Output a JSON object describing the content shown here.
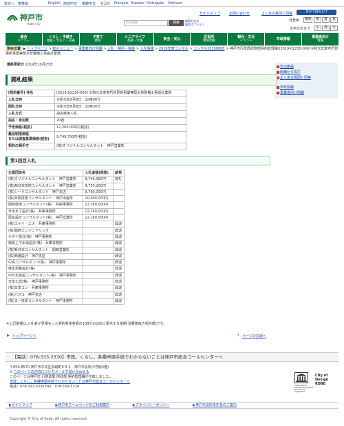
{
  "langbar": {
    "items": [
      "本文へ",
      "携帯版",
      "English",
      "简体中文",
      "繁體中文",
      "한국어",
      "Français",
      "Español",
      "Português",
      "Vietnam"
    ]
  },
  "header": {
    "logo": "神戸市",
    "logo_sub": "Kobe City",
    "sitemap": "サイトマップ",
    "contact": "お問い合わせ",
    "faq": "よくある質問と回答",
    "voice_btn": "音声で読み上げ",
    "search_placeholder": "Google",
    "search_btn": "検索",
    "help_line1": "検索の方法",
    "help_line2": "検索オプション",
    "bg_label": "背景色",
    "bg_opts": [
      "標準",
      "青",
      "黄",
      "黒"
    ],
    "fs_label": "文字の大きさ",
    "fs_opts": [
      "小",
      "標",
      "大"
    ]
  },
  "gnav": [
    {
      "label": "総合",
      "sub": "メニュー"
    },
    {
      "label": "くらし・手続き",
      "sub": "福祉・すまい・交通"
    },
    {
      "label": "子育て",
      "sub": "教育"
    },
    {
      "label": "シニアライフ",
      "sub": "高齢・介護"
    },
    {
      "label": "安全・安心",
      "sub": ""
    },
    {
      "label": "区役所",
      "sub": "地域活動"
    },
    {
      "label": "観光・文化",
      "sub": "イベント"
    },
    {
      "label": "市政情報",
      "sub": ""
    },
    {
      "label": "事業者向け",
      "sub": "情報"
    }
  ],
  "breadcrumb": {
    "label": "現在位置",
    "items": [
      "トップページ",
      "総合メニュー",
      "事業者向け情報",
      "入札・契約・税金",
      "入札情報",
      "2019年度コンサル",
      "コンサル20190808"
    ],
    "current": "神戸市行政局総務部契約監理課/[2019-02230-000]令和元年度老朽管更新事業等配水管整備工事設計業務"
  },
  "updated": {
    "label": "最終更新日",
    "date": "2019年10月25日"
  },
  "title": "開札結果",
  "info_rows": [
    {
      "k": "[契約番号] 件名",
      "v": "[2019-02230-000] 令和元年度老朽管更新事業等配水管整備工事設計業務"
    },
    {
      "k": "入札日時",
      "v": "令和元年8月8日　10時00分"
    },
    {
      "k": "開札日時",
      "v": "令和元年8月8日　10時30分"
    },
    {
      "k": "入札方式",
      "v": "指名競争入札"
    },
    {
      "k": "指名・参加数",
      "v": "20者"
    },
    {
      "k": "予定価格(税抜)",
      "v": "12,260,000円(税抜)"
    },
    {
      "k": "最低制限価格\nまたは調査基準価格(税抜)",
      "v": "9,749,700円(税抜)"
    },
    {
      "k": "契約の相手方",
      "v": "(株)オリジナルコンサルタント　神戸営業所"
    }
  ],
  "round1": "第1回目入札",
  "bid_headers": [
    "企業団体名",
    "入札金額(税抜)",
    "結果"
  ],
  "bids": [
    [
      "(株)オリジナルコンサルタント　神戸営業所",
      "9,749,900円",
      "落札"
    ],
    [
      "(株)西日本技術コンサルタント　神戸営業所",
      "9,750,200円",
      ""
    ],
    [
      "(株)シードコンサルタント　神戸支店",
      "9,760,000円",
      ""
    ],
    [
      "(株)日新技術コンサルタント　神戸出張所",
      "10,000,000円",
      ""
    ],
    [
      "関西技術コンサルタント(株)　兵庫事務所",
      "12,260,000円",
      ""
    ],
    [
      "日本水工設計(株)　兵庫事務所",
      "12,260,000円",
      ""
    ],
    [
      "阪急設計コンサルタント(株)　神戸営業所",
      "12,260,000円",
      ""
    ],
    [
      "(株)エイイーエス　兵庫事務所",
      "",
      "辞退"
    ],
    [
      "(株)関西エンジニヤリング",
      "",
      "辞退"
    ],
    [
      "キタイ設計(株)　神戸事務所",
      "",
      "辞退"
    ],
    [
      "扇年上下水道設計(株)　兵庫事務所",
      "",
      "辞退"
    ],
    [
      "(株)新日本コンサルタント　関西営業所",
      "",
      "辞退"
    ],
    [
      "(株)西播設計　神戸支店",
      "",
      "辞退"
    ],
    [
      "中央コンサルタンツ(株)　神戸事務所",
      "",
      "辞退"
    ],
    [
      "徳生測量設計(株)",
      "",
      "辞退"
    ],
    [
      "中日本建設コンサルタント(株)　神戸事務所",
      "",
      "辞退"
    ],
    [
      "日本工営(株)　神戸事務所",
      "",
      "辞退"
    ],
    [
      "(株)日本コン　兵庫事務所",
      "",
      "辞退"
    ],
    [
      "(株)パスコ　神戸支店",
      "",
      "辞退"
    ],
    [
      "(株)ヨー技研コンサルタント　神戸事務所",
      "",
      "辞退"
    ]
  ],
  "note": "※上記金額は,入札者が見積もった契約希望金額の108分の100に相当する金額(消費税抜き相当額)です。",
  "foot_links": {
    "top": "トップページへ",
    "prev": "ページの先頭へ"
  },
  "callcenter": "【電話：078-333-3330】市政，くらし，各種申請手続でわからないことは神戸市総合コールセンターへ",
  "contact": {
    "l1": "〒650-8570 神戸市中央区加納町6-5-1　神戸市役所(3号館2階)",
    "l2": "このページの内容についてメールで問い合わせる",
    "l3": "このページは神戸市 行財政局 財政部 契約監理課が作成しました。",
    "l4": "市政，くらし，各種申請手続でわからないことは神戸市総合コールセンターへ",
    "l5": "電話：078-333-3330 Fax：078-333-3314"
  },
  "unesco": {
    "text": "United Nations Educational, Scientific and Cultural Organization",
    "city": "City of Design KOBE"
  },
  "bottombar": [
    "サイトマップ",
    "神戸市ホームページのご利用案内",
    "プライバシーポリシー",
    "神戸市役所本庁舎のご案内"
  ],
  "copyright": "Copyright © City of Kobe. All rights reserved.",
  "side": [
    "市の施設",
    "組織から探す",
    "よくある質問と回答",
    "市政情報",
    "事業者向け情報"
  ],
  "colors": {
    "green": "#0a7a40",
    "link": "#1a44a8",
    "crumb_bg": "#f4e2b3"
  }
}
